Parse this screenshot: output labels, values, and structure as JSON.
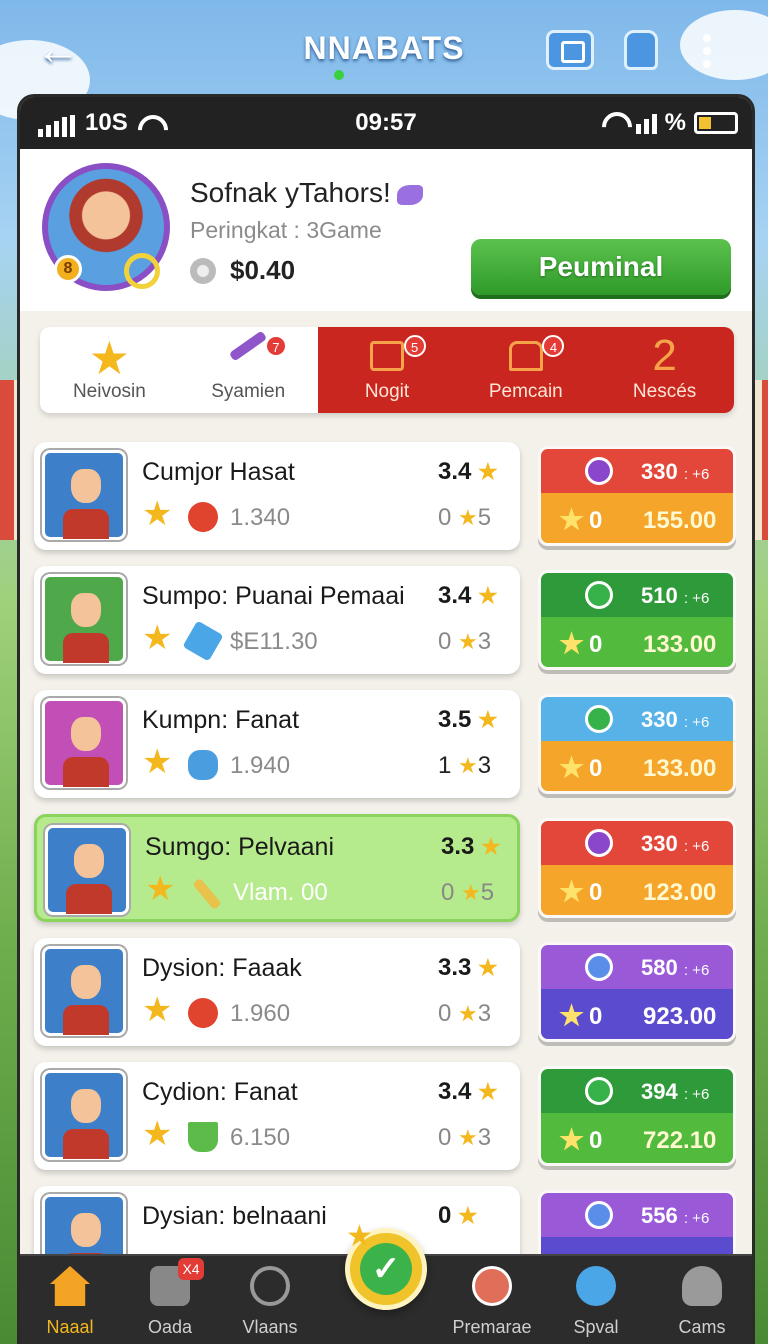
{
  "header": {
    "title": "NNABATS"
  },
  "status_bar": {
    "carrier": "10S",
    "time": "09:57",
    "battery_label": "%"
  },
  "profile": {
    "name": "Sofnak yTahors!",
    "rank": "Peringkat : 3Game",
    "balance": "$0.40",
    "badge_number": "8",
    "primary_button": "Peuminal"
  },
  "categories": [
    {
      "label": "Neivosin",
      "icon": "star-icon"
    },
    {
      "label": "Syamien",
      "icon": "wand-icon",
      "notification": "7"
    },
    {
      "label": "Nogit",
      "icon": "ticket-icon",
      "notification": "5"
    },
    {
      "label": "Pemcain",
      "icon": "shop-icon",
      "notification": "4"
    },
    {
      "label": "Nescés",
      "icon": "number-two-icon",
      "big_number": "2"
    }
  ],
  "rows": [
    {
      "name": "Cumjor Hasat",
      "rating": "3.4",
      "price": "1.340",
      "count": "0",
      "count_stars": "5",
      "item": "apple-icon",
      "thumb_color": "blue",
      "badge": {
        "score": "330",
        "suffix": ": +6",
        "zero": "0",
        "amount": "155.00",
        "color": "orange"
      }
    },
    {
      "name": "Sumpo: Puanai Pemaai",
      "rating": "3.4",
      "price": "$E11.30",
      "count": "0",
      "count_stars": "3",
      "item": "arrow-icon",
      "thumb_color": "green",
      "badge": {
        "score": "510",
        "suffix": ": +6",
        "zero": "0",
        "amount": "133.00",
        "color": "green"
      }
    },
    {
      "name": "Kumpn: Fanat",
      "rating": "3.5",
      "price": "1.940",
      "count": "1",
      "count_stars": "3",
      "item": "fish-icon",
      "thumb_color": "pink",
      "badge": {
        "score": "330",
        "suffix": ": +6",
        "zero": "0",
        "amount": "133.00",
        "color": "blue"
      }
    },
    {
      "name": "Sumgo: Pelvaani",
      "rating": "3.3",
      "price": "Vlam. 00",
      "count": "0",
      "count_stars": "5",
      "item": "pen-icon",
      "thumb_color": "blue",
      "highlight": true,
      "badge": {
        "score": "330",
        "suffix": ": +6",
        "zero": "0",
        "amount": "123.00",
        "color": "orange"
      }
    },
    {
      "name": "Dysion: Faaak",
      "rating": "3.3",
      "price": "1.960",
      "count": "0",
      "count_stars": "3",
      "item": "apple-icon",
      "thumb_color": "blue",
      "badge": {
        "score": "580",
        "suffix": ": +6",
        "zero": "0",
        "amount": "923.00",
        "color": "purple"
      }
    },
    {
      "name": "Cydion: Fanat",
      "rating": "3.4",
      "price": "6.150",
      "count": "0",
      "count_stars": "3",
      "item": "cup-icon",
      "thumb_color": "blue",
      "badge": {
        "score": "394",
        "suffix": ": +6",
        "zero": "0",
        "amount": "722.10",
        "color": "green"
      }
    },
    {
      "name": "Dysian: belnaani",
      "rating": "0",
      "price": "",
      "count": "",
      "count_stars": "",
      "item": "",
      "thumb_color": "blue",
      "badge": {
        "score": "556",
        "suffix": ": +6",
        "zero": "",
        "amount": "",
        "color": "purple"
      }
    }
  ],
  "bottom_nav": [
    {
      "label": "Naaal",
      "icon": "home-icon",
      "active": true
    },
    {
      "label": "Oada",
      "icon": "lock-icon",
      "badge": "X4"
    },
    {
      "label": "Vlaans",
      "icon": "radar-icon"
    },
    {
      "label": "Premarae",
      "icon": "avatar-icon"
    },
    {
      "label": "Spval",
      "icon": "spiral-icon"
    },
    {
      "label": "Cams",
      "icon": "person-icon"
    }
  ],
  "fab": {
    "icon": "check-icon"
  }
}
